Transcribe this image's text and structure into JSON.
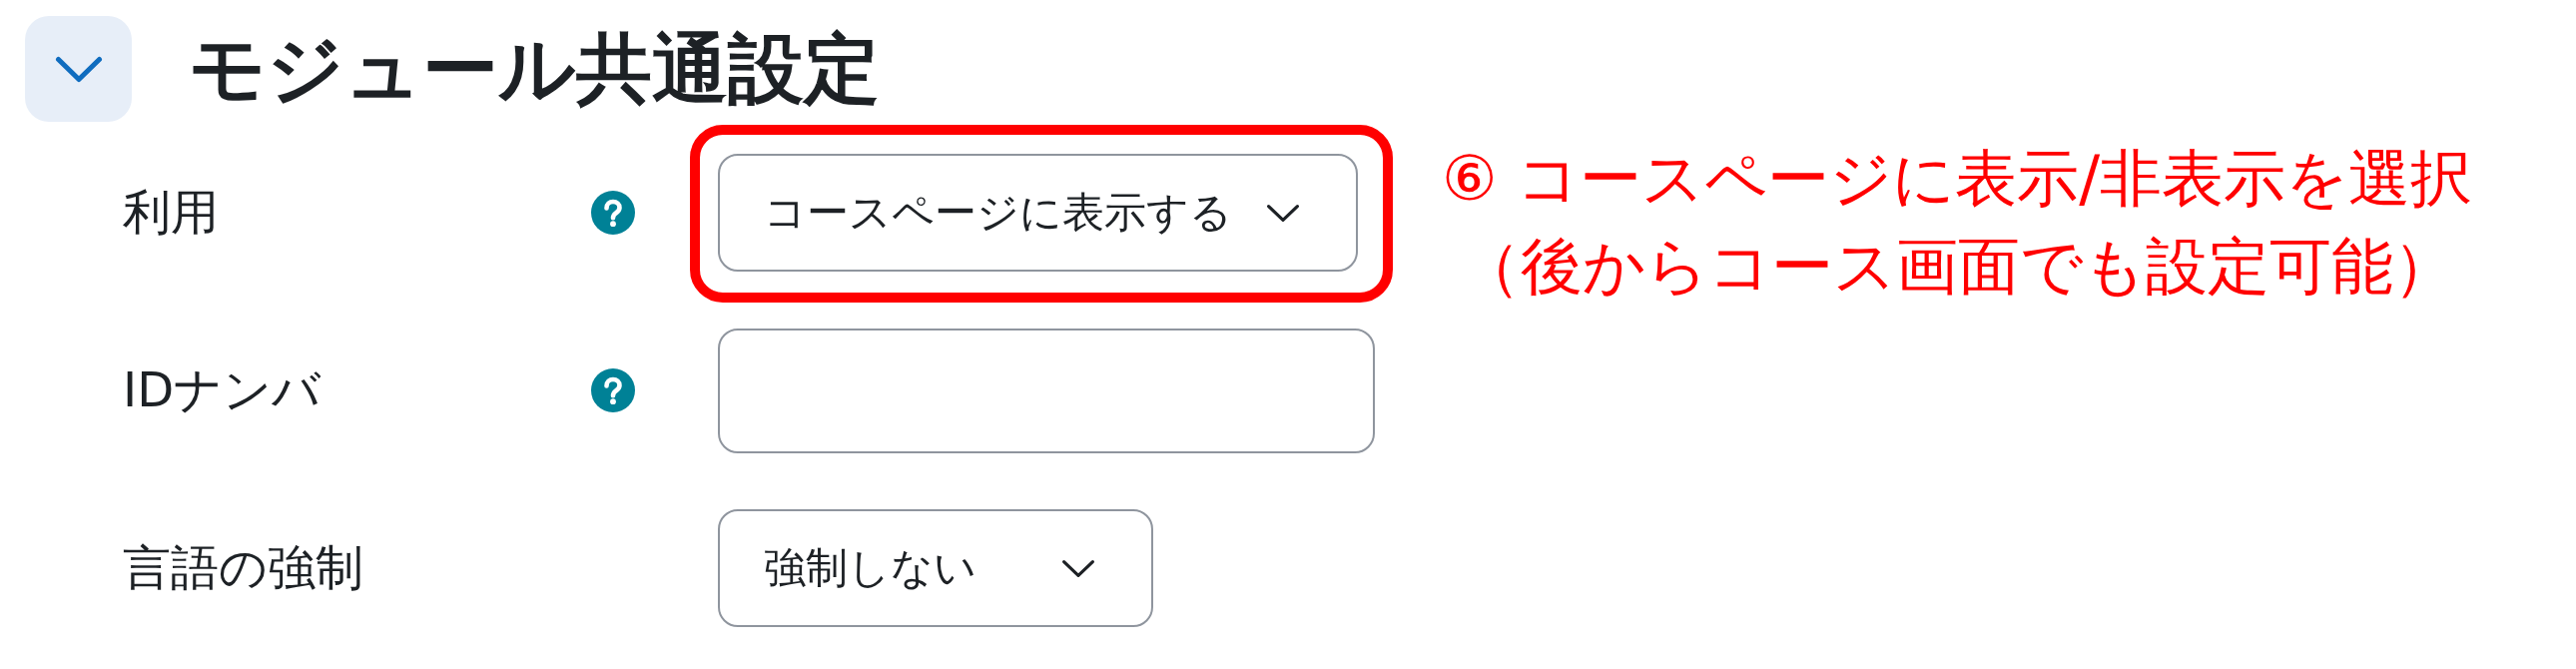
{
  "section": {
    "title": "モジュール共通設定",
    "expanded": true
  },
  "fields": [
    {
      "kind": "select",
      "label": "利用",
      "help": true,
      "value": "コースページに表示する",
      "highlighted": true,
      "callout": [
        "⑥ コースページに表示/非表示を選択",
        "（後からコース画面でも設定可能）"
      ]
    },
    {
      "kind": "text",
      "label": "IDナンバ",
      "help": true,
      "highlighted": false
    },
    {
      "kind": "select",
      "label": "言語の強制",
      "help": false,
      "value": "強制しない",
      "highlighted": false
    }
  ]
}
